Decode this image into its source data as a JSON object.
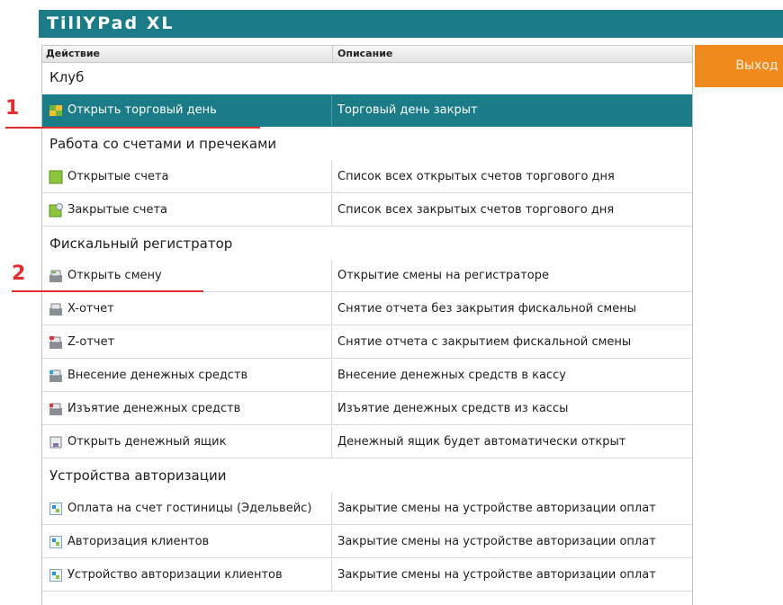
{
  "app": {
    "title": "TillYPad XL"
  },
  "columns": {
    "action": "Действие",
    "description": "Описание"
  },
  "exit_button": "Выход",
  "markers": [
    "1",
    "2"
  ],
  "colors": {
    "header": "#1b7b86",
    "selected": "#1b7b86",
    "exit": "#f08a1c",
    "marker": "#e32d2d"
  },
  "rows": [
    {
      "type": "group",
      "label": "Клуб"
    },
    {
      "type": "item",
      "icon": "open-day-icon",
      "label": "Открыть торговый день",
      "desc": "Торговый день закрыт",
      "selected": true
    },
    {
      "type": "group",
      "label": "Работа со счетами и пречеками"
    },
    {
      "type": "item",
      "icon": "open-bills-icon",
      "label": "Открытые счета",
      "desc": "Список всех открытых счетов торгового дня"
    },
    {
      "type": "item",
      "icon": "closed-bills-icon",
      "label": "Закрытые счета",
      "desc": "Список всех закрытых счетов торгового дня"
    },
    {
      "type": "group",
      "label": "Фискальный регистратор"
    },
    {
      "type": "item",
      "icon": "open-shift-icon",
      "label": "Открыть смену",
      "desc": "Открытие смены на регистраторе"
    },
    {
      "type": "item",
      "icon": "x-report-icon",
      "label": "X-отчет",
      "desc": "Снятие отчета без закрытия фискальной смены"
    },
    {
      "type": "item",
      "icon": "z-report-icon",
      "label": "Z-отчет",
      "desc": "Снятие отчета с закрытием фискальной смены"
    },
    {
      "type": "item",
      "icon": "cash-in-icon",
      "label": "Внесение денежных средств",
      "desc": "Внесение денежных средств в кассу"
    },
    {
      "type": "item",
      "icon": "cash-out-icon",
      "label": "Изъятие денежных средств",
      "desc": "Изъятие денежных средств из кассы"
    },
    {
      "type": "item",
      "icon": "cash-drawer-icon",
      "label": "Открыть денежный ящик",
      "desc": "Денежный ящик будет автоматически открыт"
    },
    {
      "type": "group",
      "label": "Устройства авторизации"
    },
    {
      "type": "item",
      "icon": "auth-device-icon",
      "label": "Оплата на счет гостиницы (Эдельвейс)",
      "desc": "Закрытие смены на устройстве авторизации оплат"
    },
    {
      "type": "item",
      "icon": "auth-device-icon",
      "label": "Авторизация клиентов",
      "desc": "Закрытие смены на устройстве авторизации оплат"
    },
    {
      "type": "item",
      "icon": "auth-device-icon",
      "label": "Устройство авторизации клиентов",
      "desc": "Закрытие смены на устройстве авторизации оплат"
    }
  ]
}
